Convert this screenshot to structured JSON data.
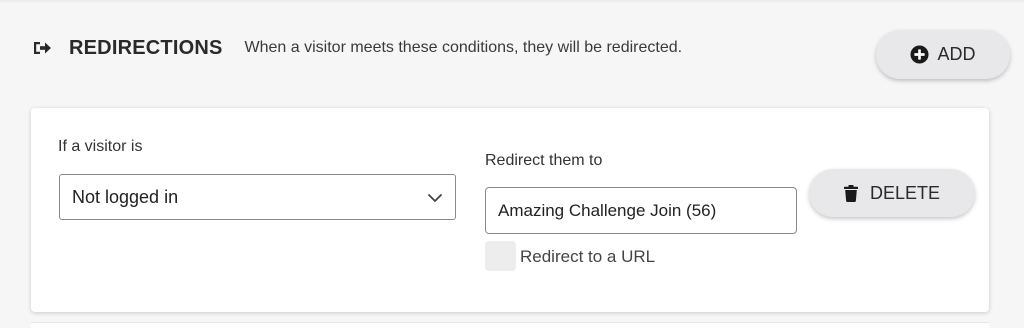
{
  "section": {
    "icon": "sign-out-icon",
    "title": "REDIRECTIONS",
    "description": "When a visitor meets these conditions, they will be redirected."
  },
  "add_button": {
    "icon": "plus-circle-icon",
    "label": "ADD"
  },
  "rule": {
    "condition_label": "If a visitor is",
    "condition_value": "Not logged in",
    "redirect_label": "Redirect them to",
    "redirect_value": "Amazing Challenge Join (56)",
    "url_checkbox_label": "Redirect to a URL",
    "url_checkbox_checked": false,
    "delete_button": {
      "icon": "trash-icon",
      "label": "DELETE"
    }
  }
}
